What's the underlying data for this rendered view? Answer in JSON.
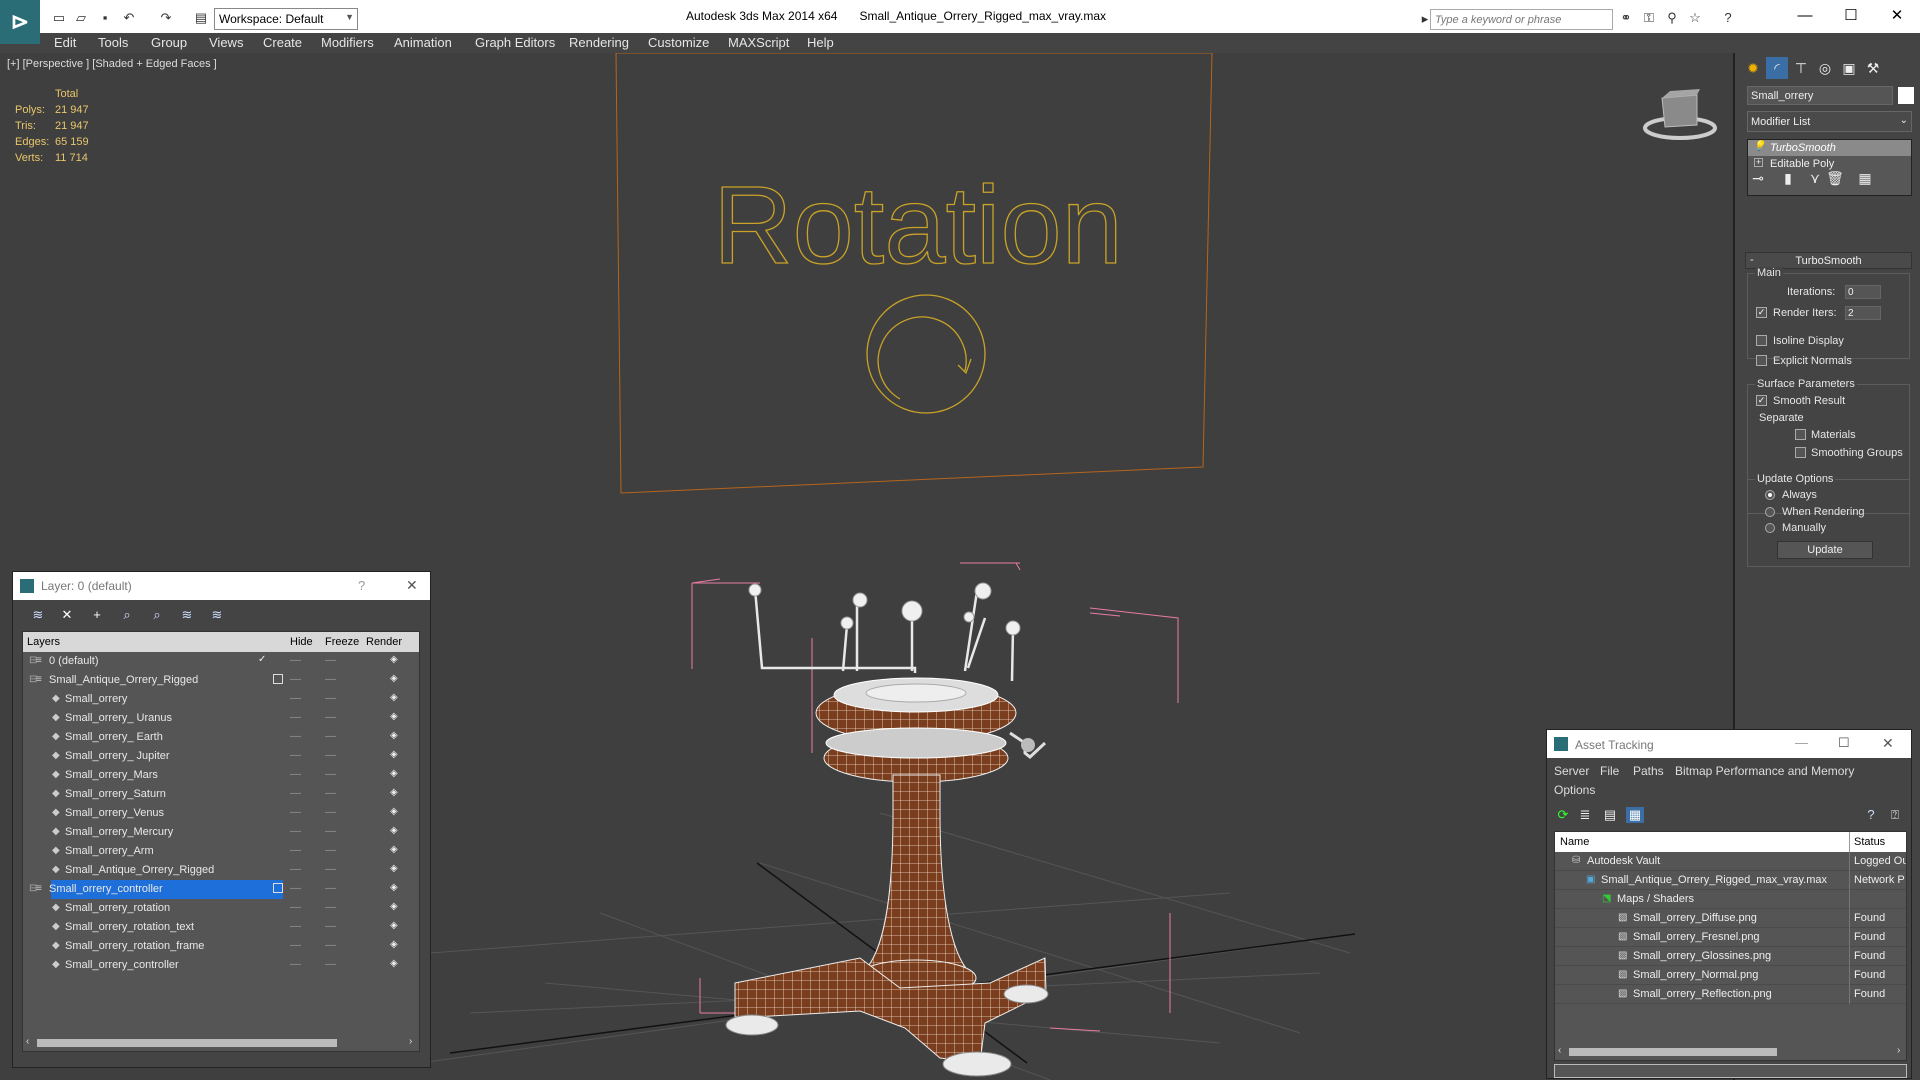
{
  "window": {
    "app_title": "Autodesk 3ds Max  2014 x64",
    "file_title": "Small_Antique_Orrery_Rigged_max_vray.max",
    "workspace": "Workspace: Default",
    "search_placeholder": "Type a keyword or phrase"
  },
  "menu": [
    "Edit",
    "Tools",
    "Group",
    "Views",
    "Create",
    "Modifiers",
    "Animation",
    "Graph Editors",
    "Rendering",
    "Customize",
    "MAXScript",
    "Help"
  ],
  "viewport": {
    "label": "[+] [Perspective ] [Shaded + Edged Faces ]",
    "stats_header": "Total",
    "stats": [
      {
        "label": "Polys:",
        "value": "21 947"
      },
      {
        "label": "Tris:",
        "value": "21 947"
      },
      {
        "label": "Edges:",
        "value": "65 159"
      },
      {
        "label": "Verts:",
        "value": "11 714"
      }
    ],
    "scene_text": "Rotation"
  },
  "layer_panel": {
    "title": "Layer: 0 (default)",
    "help": "?",
    "columns": {
      "layers": "Layers",
      "hide": "Hide",
      "freeze": "Freeze",
      "render": "Render"
    },
    "rows": [
      {
        "name": "0 (default)",
        "level": 0
      },
      {
        "name": "Small_Antique_Orrery_Rigged",
        "level": 0
      },
      {
        "name": "Small_orrery",
        "level": 1
      },
      {
        "name": "Small_orrery_ Uranus",
        "level": 1
      },
      {
        "name": "Small_orrery_ Earth",
        "level": 1
      },
      {
        "name": "Small_orrery_ Jupiter",
        "level": 1
      },
      {
        "name": "Small_orrery_Mars",
        "level": 1
      },
      {
        "name": "Small_orrery_Saturn",
        "level": 1
      },
      {
        "name": "Small_orrery_Venus",
        "level": 1
      },
      {
        "name": "Small_orrery_Mercury",
        "level": 1
      },
      {
        "name": "Small_orrery_Arm",
        "level": 1
      },
      {
        "name": "Small_Antique_Orrery_Rigged",
        "level": 1
      },
      {
        "name": "Small_orrery_controller",
        "level": 0
      },
      {
        "name": "Small_orrery_rotation",
        "level": 1
      },
      {
        "name": "Small_orrery_rotation_text",
        "level": 1
      },
      {
        "name": "Small_orrery_rotation_frame",
        "level": 1
      },
      {
        "name": "Small_orrery_controller",
        "level": 1
      }
    ]
  },
  "command_panel": {
    "object_name": "Small_orrery",
    "modifier_list": "Modifier List",
    "stack": [
      "TurboSmooth",
      "Editable Poly"
    ],
    "rollout_title": "TurboSmooth",
    "main_label": "Main",
    "iterations_label": "Iterations:",
    "iterations_value": "0",
    "render_iters_label": "Render Iters:",
    "render_iters_value": "2",
    "render_iters_checked": true,
    "isoline_label": "Isoline Display",
    "explicit_normals_label": "Explicit Normals",
    "surface_params_label": "Surface Parameters",
    "smooth_result_label": "Smooth Result",
    "smooth_result_checked": true,
    "separate_label": "Separate",
    "materials_label": "Materials",
    "smoothing_groups_label": "Smoothing Groups",
    "update_options_label": "Update Options",
    "always_label": "Always",
    "when_rendering_label": "When Rendering",
    "manually_label": "Manually",
    "update_button": "Update"
  },
  "asset_tracking": {
    "title": "Asset Tracking",
    "menu": [
      "Server",
      "File",
      "Paths",
      "Bitmap Performance and Memory"
    ],
    "menu2": "Options",
    "columns": {
      "name": "Name",
      "status": "Status"
    },
    "rows": [
      {
        "name": "Autodesk Vault",
        "status": "Logged Ou",
        "level": 0
      },
      {
        "name": "Small_Antique_Orrery_Rigged_max_vray.max",
        "status": "Network P",
        "level": 1
      },
      {
        "name": "Maps / Shaders",
        "status": "",
        "level": 2
      },
      {
        "name": "Small_orrery_Diffuse.png",
        "status": "Found",
        "level": 3
      },
      {
        "name": "Small_orrery_Fresnel.png",
        "status": "Found",
        "level": 3
      },
      {
        "name": "Small_orrery_Glossines.png",
        "status": "Found",
        "level": 3
      },
      {
        "name": "Small_orrery_Normal.png",
        "status": "Found",
        "level": 3
      },
      {
        "name": "Small_orrery_Reflection.png",
        "status": "Found",
        "level": 3
      }
    ]
  }
}
